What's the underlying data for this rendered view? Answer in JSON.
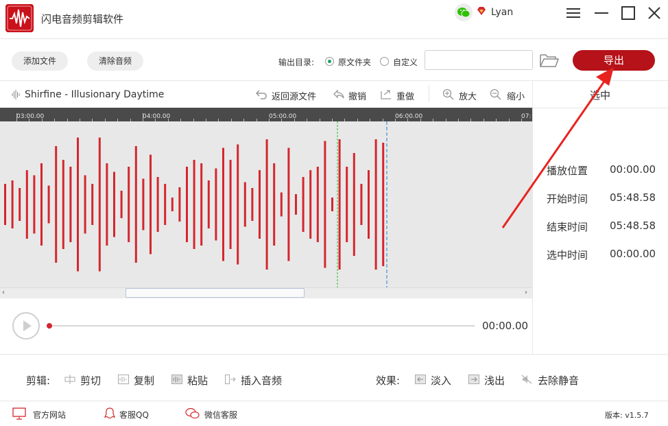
{
  "titlebar": {
    "app_title": "闪电音频剪辑软件",
    "username": "Lyan",
    "icons": [
      "app-logo-icon",
      "wechat-icon",
      "vip-diamond-icon",
      "menu-icon",
      "minimize-icon",
      "maximize-icon",
      "close-icon"
    ]
  },
  "toolbar": {
    "add_file": "添加文件",
    "clear_audio": "清除音频",
    "output_label": "输出目录:",
    "radio_source": "原文件夹",
    "radio_custom": "自定义",
    "selected_radio": "原文件夹",
    "path_value": "",
    "export": "导出",
    "accent_color": "#b51219"
  },
  "editor": {
    "file_name": "Shirfine - Illusionary Daytime",
    "back_to_source": "返回源文件",
    "undo": "撤销",
    "redo": "重做",
    "zoom_in": "放大",
    "zoom_out": "缩小",
    "ruler_labels": [
      "03:00.00",
      "04:00.00",
      "05:00.00",
      "06:00.00",
      "07:"
    ],
    "waveform_color": "#d4262d"
  },
  "player": {
    "time": "00:00.00",
    "progress_fraction": 0
  },
  "selection": {
    "title": "选中",
    "rows": [
      {
        "label": "播放位置",
        "value": "00:00.00"
      },
      {
        "label": "开始时间",
        "value": "05:48.58"
      },
      {
        "label": "结束时间",
        "value": "05:48.58"
      },
      {
        "label": "选中时间",
        "value": "00:00.00"
      }
    ]
  },
  "edit_bar": {
    "edit_label": "剪辑:",
    "cut": "剪切",
    "copy": "复制",
    "paste": "粘贴",
    "insert_audio": "插入音频",
    "effects_label": "效果:",
    "fade_in": "淡入",
    "fade_out": "浅出",
    "remove_silence": "去除静音"
  },
  "footer": {
    "website": "官方网站",
    "qq_service": "客服QQ",
    "wechat_service": "微信客服",
    "version": "版本: v1.5.7"
  }
}
